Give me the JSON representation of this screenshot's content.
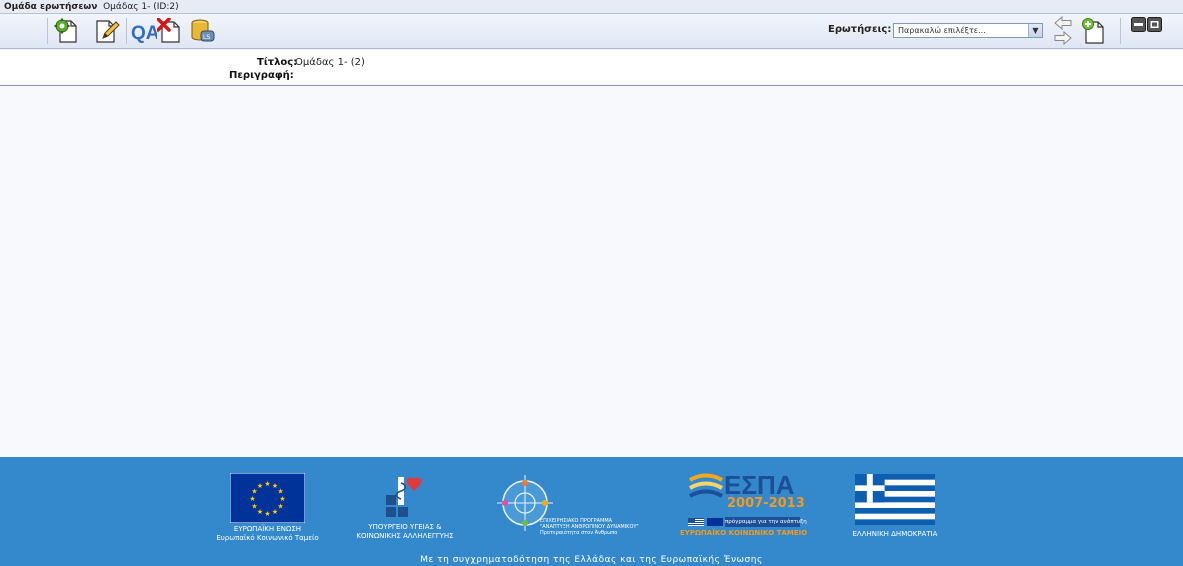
{
  "titlebar": {
    "section": "Ομάδα ερωτήσεων",
    "item": "Ομάδας 1- (ID:2)"
  },
  "toolbar": {
    "icons": [
      "gear-document-icon",
      "edit-document-icon",
      "qa-icon",
      "delete-document-icon",
      "database-export-icon"
    ],
    "questions_label": "Ερωτήσεις:",
    "questions_select_value": "Παρακαλώ επιλέξτε...",
    "nav_icons": [
      "arrow-left-icon",
      "arrow-right-icon",
      "add-document-icon",
      "window-toggle-icon"
    ]
  },
  "info": {
    "title_label": "Τίτλος:",
    "title_value": "Ομάδας 1- (2)",
    "description_label": "Περιγραφή:",
    "description_value": ""
  },
  "footer": {
    "logos": [
      {
        "name": "eu-flag-logo",
        "caption_line1": "ΕΥΡΩΠΑΪΚΗ ΕΝΩΣΗ",
        "caption_line2": "Ευρωπαϊκό Κοινωνικό Ταμείο"
      },
      {
        "name": "ministry-logo",
        "caption_line1": "ΥΠΟΥΡΓΕΙΟ ΥΓΕΙΑΣ &",
        "caption_line2": "ΚΟΙΝΩΝΙΚΗΣ ΑΛΛΗΛΕΓΓΥΗΣ"
      },
      {
        "name": "operational-programme-logo",
        "caption_line1": "ΕΠΙΧΕΙΡΗΣΙΑΚΟ ΠΡΟΓΡΑΜΜΑ",
        "caption_line2": "\"ΑΝΑΠΤΥΞΗ ΑΝΘΡΩΠΙΝΟΥ ΔΥΝΑΜΙΚΟΥ\"",
        "caption_line3": "Προτεραιότητα στον Άνθρωπο"
      },
      {
        "name": "espa-logo",
        "brand": "ΕΣΠΑ",
        "years": "2007-2013",
        "tagline": "πρόγραμμα για την ανάπτυξη",
        "caption": "ΕΥΡΩΠΑΪΚΟ ΚΟΙΝΩΝΙΚΟ ΤΑΜΕΙΟ"
      },
      {
        "name": "greek-flag-logo",
        "caption": "ΕΛΛΗΝΙΚΗ ΔΗΜΟΚΡΑΤΙΑ"
      }
    ],
    "cofinancing_text": "Με τη συγχρηματοδότηση της Ελλάδας και της Ευρωπαϊκής Ένωσης"
  },
  "colors": {
    "footer_bg": "#3389cc",
    "toolbar_bg": "#e2e8f5",
    "content_bg": "#f7f9fd",
    "espa_orange": "#f39a1e"
  }
}
